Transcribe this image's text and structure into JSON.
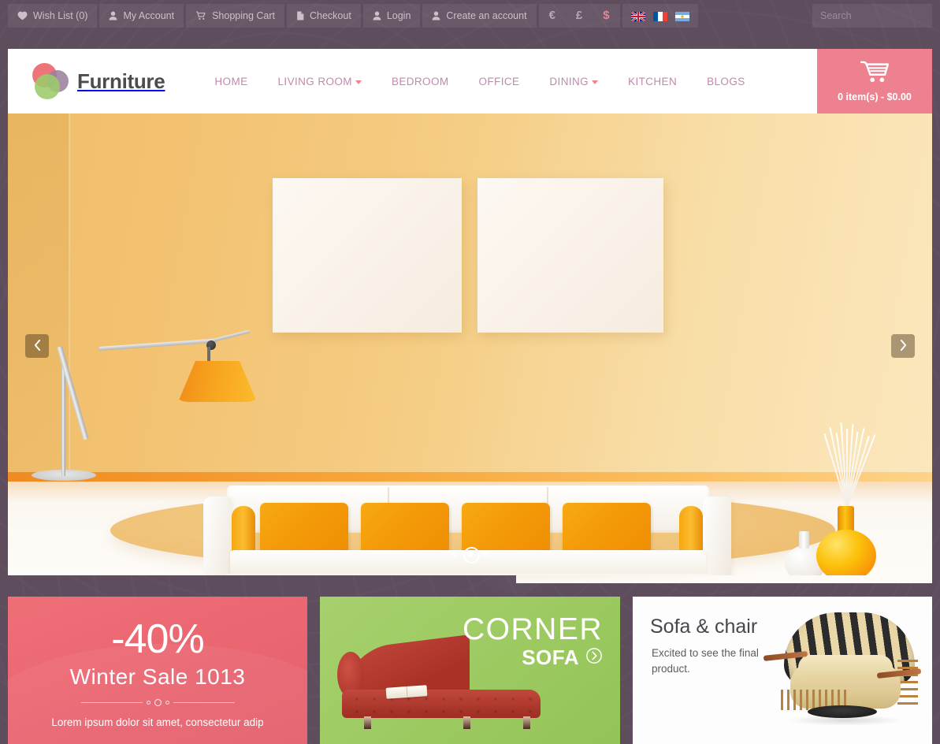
{
  "topbar": {
    "links": [
      {
        "label": "Wish List (0)",
        "icon": "heart-icon"
      },
      {
        "label": "My Account",
        "icon": "user-icon"
      },
      {
        "label": "Shopping Cart",
        "icon": "cart-icon"
      },
      {
        "label": "Checkout",
        "icon": "file-icon"
      },
      {
        "label": "Login",
        "icon": "user-icon"
      },
      {
        "label": "Create an account",
        "icon": "user-icon"
      }
    ],
    "currencies": [
      {
        "symbol": "€",
        "name": "euro",
        "active": false
      },
      {
        "symbol": "£",
        "name": "pound",
        "active": false
      },
      {
        "symbol": "$",
        "name": "dollar",
        "active": true
      }
    ],
    "languages": [
      {
        "name": "english-flag"
      },
      {
        "name": "french-flag"
      },
      {
        "name": "argentina-flag"
      }
    ]
  },
  "search": {
    "placeholder": "Search",
    "value": "",
    "icon": "search-icon"
  },
  "header": {
    "logo_text": "Furniture",
    "nav": [
      {
        "label": "HOME",
        "dropdown": false
      },
      {
        "label": "LIVING ROOM",
        "dropdown": true
      },
      {
        "label": "BEDROOM",
        "dropdown": false
      },
      {
        "label": "OFFICE",
        "dropdown": false
      },
      {
        "label": "DINING",
        "dropdown": true
      },
      {
        "label": "KITCHEN",
        "dropdown": false
      },
      {
        "label": "BLOGS",
        "dropdown": false
      }
    ],
    "cart": {
      "label": "0 item(s) - $0.00",
      "icon": "shopping-cart-icon",
      "color": "#ee8190"
    }
  },
  "slider": {
    "prev_icon": "chevron-left-icon",
    "next_icon": "chevron-right-icon",
    "slide_count": 3,
    "active_slide": 2
  },
  "promos": [
    {
      "headline": "-40%",
      "subhead": "Winter Sale  1013",
      "text": "Lorem ipsum dolor sit amet, consectetur adip",
      "color": "#ea6671"
    },
    {
      "title": "CORNER",
      "subtitle": "SOFA",
      "arrow_icon": "circle-arrow-right-icon",
      "color": "#9ecb63"
    },
    {
      "title": "Sofa & chair",
      "text": "Excited to see the final product.",
      "color": "#fdfdfd"
    }
  ]
}
